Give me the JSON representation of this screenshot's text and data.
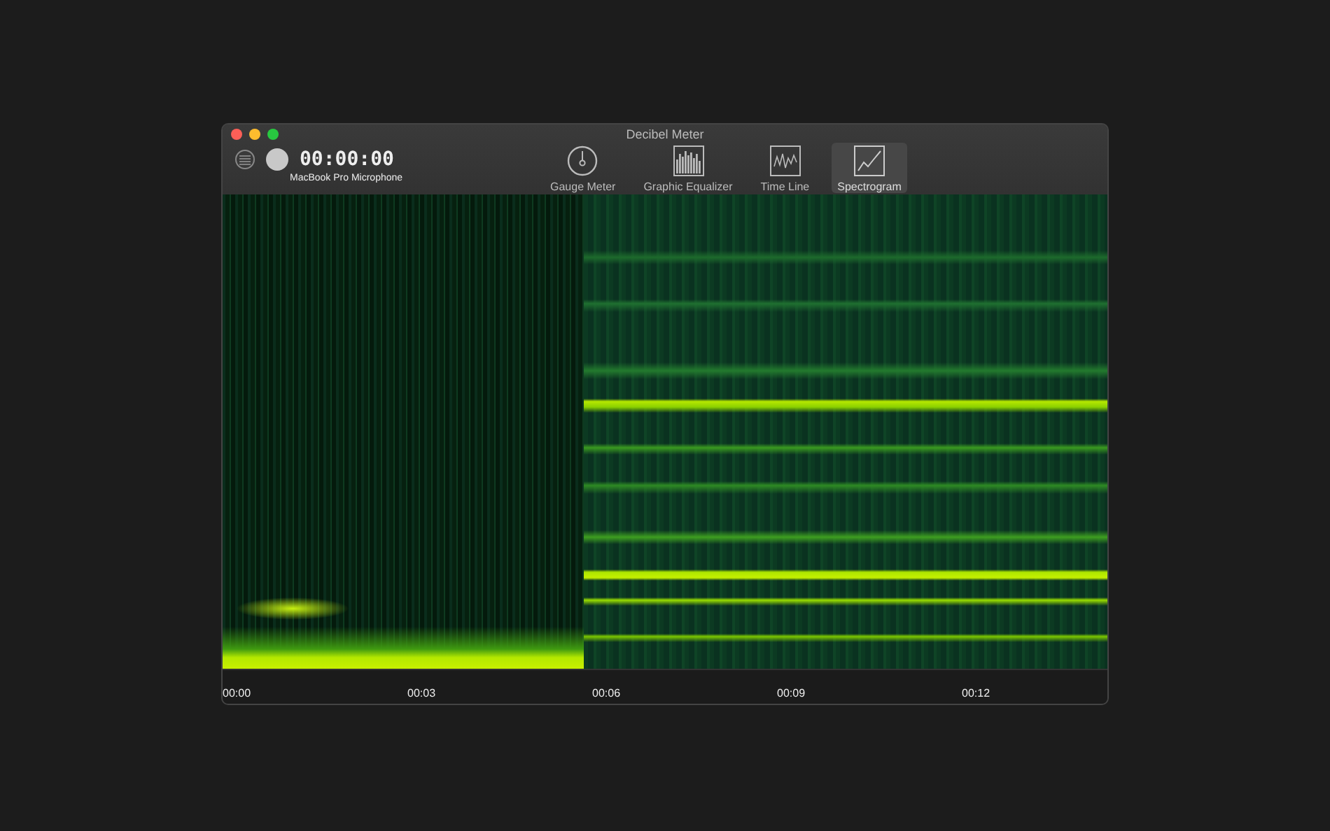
{
  "window": {
    "title": "Decibel Meter"
  },
  "recorder": {
    "timer": "00:00:00",
    "input_device": "MacBook Pro Microphone"
  },
  "tabs": [
    {
      "label": "Gauge Meter",
      "kind": "gauge",
      "selected": false
    },
    {
      "label": "Graphic Equalizer",
      "kind": "equalizer",
      "selected": false
    },
    {
      "label": "Time Line",
      "kind": "timeline",
      "selected": false
    },
    {
      "label": "Spectrogram",
      "kind": "spectrogram",
      "selected": true
    }
  ],
  "time_axis": {
    "labels": [
      "00:00",
      "00:03",
      "00:06",
      "00:09",
      "00:12"
    ]
  }
}
